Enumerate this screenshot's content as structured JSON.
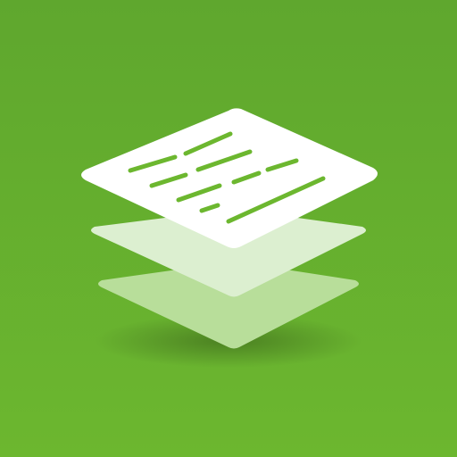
{
  "icon": {
    "name": "stacked-documents-icon",
    "colors": {
      "background_top": "#5fa72e",
      "background_bottom": "#6cb72f",
      "top_sheet": "#ffffff",
      "middle_sheet": "#dcefd0",
      "bottom_sheet": "#b8de9a",
      "text_lines": "#6cb72f"
    },
    "layers": 3,
    "text_line_rows": 4
  }
}
